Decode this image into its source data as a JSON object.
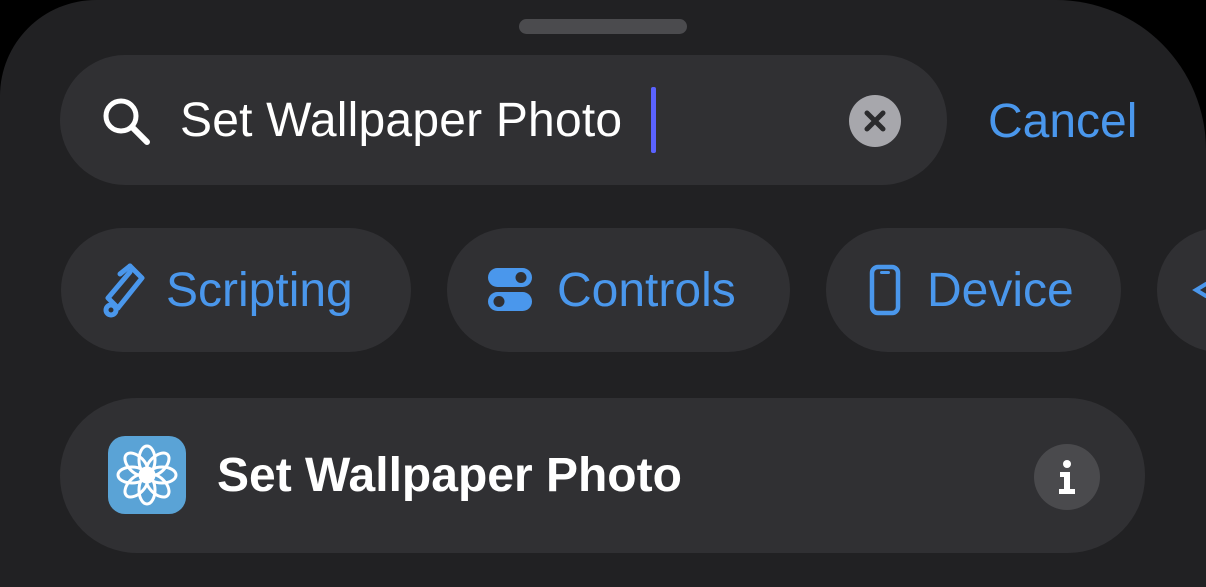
{
  "search": {
    "value": "Set Wallpaper Photo",
    "cancel_label": "Cancel"
  },
  "categories": [
    {
      "label": "Scripting",
      "icon": "scripting-icon"
    },
    {
      "label": "Controls",
      "icon": "controls-icon"
    },
    {
      "label": "Device",
      "icon": "device-icon"
    }
  ],
  "results": [
    {
      "title": "Set Wallpaper Photo",
      "icon": "photos-flower-icon"
    }
  ],
  "colors": {
    "accent": "#4a97ec",
    "sheet_background": "#212123",
    "field_background": "#303033",
    "caret": "#5a62ff",
    "app_icon_background": "#5aa3d6"
  }
}
